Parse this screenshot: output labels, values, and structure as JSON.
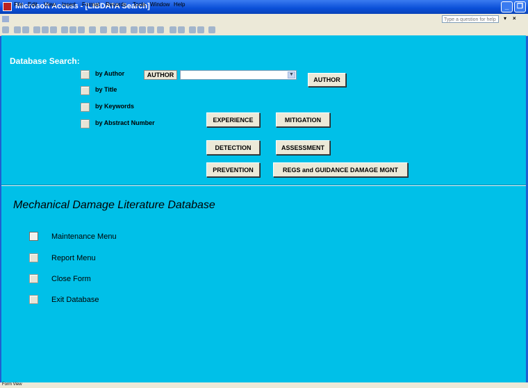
{
  "window": {
    "title": "Microsoft Access - [LIBDATA Search]",
    "controls": [
      "minimize-icon",
      "restore-icon"
    ]
  },
  "menubar": {
    "items": [
      "File",
      "Edit",
      "View",
      "Insert",
      "Format",
      "Records",
      "Tools",
      "Window",
      "Help"
    ],
    "help_placeholder": "Type a question for help"
  },
  "search": {
    "heading": "Database Search:",
    "options": [
      "by Author",
      "by Title",
      "by Keywords",
      "by Abstract Number"
    ],
    "author_label": "AUTHOR",
    "author_value": "",
    "author_button": "AUTHOR",
    "topic_buttons": {
      "experience": "EXPERIENCE",
      "mitigation": "MITIGATION",
      "detection": "DETECTION",
      "assessment": "ASSESSMENT",
      "prevention": "PREVENTION",
      "regs": "REGS and GUIDANCE DAMAGE MGNT"
    }
  },
  "main": {
    "title": "Mechanical Damage Literature Database",
    "menu_items": [
      "Maintenance Menu",
      "Report Menu",
      "Close Form",
      "Exit Database"
    ]
  },
  "status": {
    "text": "Form View"
  },
  "colors": {
    "form_background": "#00c0e8",
    "title_bar": "#0a4fd8",
    "chrome": "#ece9d8"
  }
}
